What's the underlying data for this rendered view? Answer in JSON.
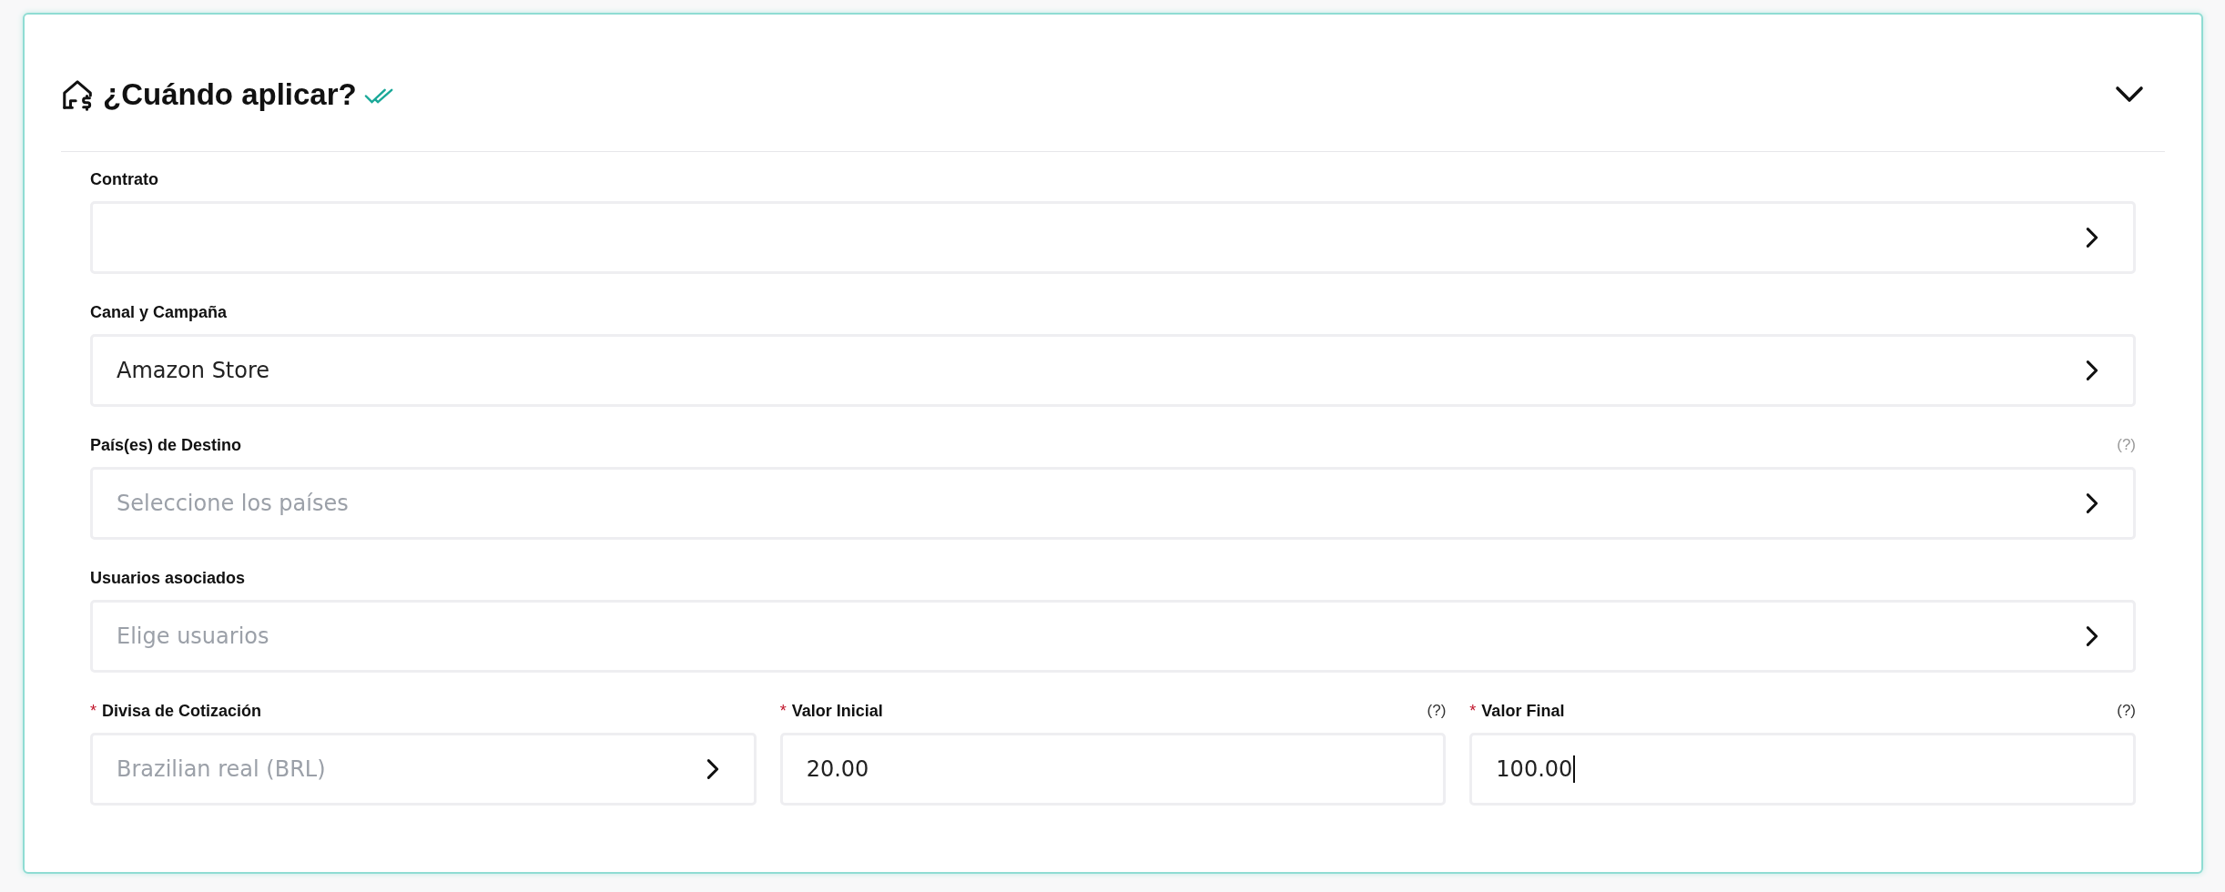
{
  "panel": {
    "title": "¿Cuándo aplicar?",
    "expanded": true,
    "completed": true
  },
  "rows": [
    [
      {
        "kind": "select",
        "label": "Contrato"
      }
    ],
    [
      {
        "kind": "select",
        "label": "Canal y Campaña",
        "value": "Amazon Store"
      }
    ],
    [
      {
        "kind": "select",
        "label": "País(es) de Destino",
        "help": "(?)",
        "placeholder": "Seleccione los países"
      }
    ],
    [
      {
        "kind": "select",
        "label": "Usuarios asociados",
        "placeholder": "Elige usuarios"
      }
    ],
    [
      {
        "kind": "select",
        "label": "Divisa de Cotización",
        "required": "*",
        "placeholder": "Brazilian real (BRL)"
      },
      {
        "kind": "input",
        "label": "Valor Inicial",
        "required": "*",
        "help": "(?)",
        "value": "20.00"
      },
      {
        "kind": "input",
        "label": "Valor Final",
        "required": "*",
        "help": "(?)",
        "value": "100.00",
        "focused": true
      }
    ]
  ]
}
